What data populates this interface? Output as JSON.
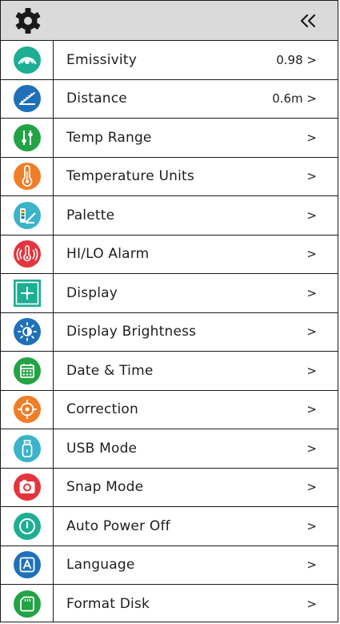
{
  "header": {
    "settings_icon": "gear-icon",
    "back_icon": "double-chevron-left-icon"
  },
  "colors": {
    "teal": "#1dae93",
    "blue": "#1f70b8",
    "green": "#22a344",
    "orange": "#f07d28",
    "cyan": "#3bb3c9",
    "red": "#e5343c",
    "header_bg": "#dadada"
  },
  "menu": {
    "items": [
      {
        "label": "Emissivity",
        "value": "0.98 >",
        "icon": "emissivity-icon"
      },
      {
        "label": "Distance",
        "value": "0.6m >",
        "icon": "distance-icon"
      },
      {
        "label": "Temp Range",
        "value": ">",
        "icon": "temp-range-icon"
      },
      {
        "label": "Temperature Units",
        "value": ">",
        "icon": "thermometer-icon"
      },
      {
        "label": "Palette",
        "value": ">",
        "icon": "palette-icon"
      },
      {
        "label": "HI/LO Alarm",
        "value": ">",
        "icon": "alarm-icon"
      },
      {
        "label": "Display",
        "value": ">",
        "icon": "display-icon"
      },
      {
        "label": "Display Brightness",
        "value": ">",
        "icon": "brightness-icon"
      },
      {
        "label": "Date & Time",
        "value": ">",
        "icon": "calendar-icon"
      },
      {
        "label": "Correction",
        "value": ">",
        "icon": "crosshair-icon"
      },
      {
        "label": "USB Mode",
        "value": ">",
        "icon": "usb-icon"
      },
      {
        "label": "Snap Mode",
        "value": ">",
        "icon": "camera-icon"
      },
      {
        "label": "Auto Power Off",
        "value": ">",
        "icon": "power-icon"
      },
      {
        "label": "Language",
        "value": ">",
        "icon": "language-icon"
      },
      {
        "label": "Format Disk",
        "value": ">",
        "icon": "sd-card-icon"
      }
    ]
  }
}
